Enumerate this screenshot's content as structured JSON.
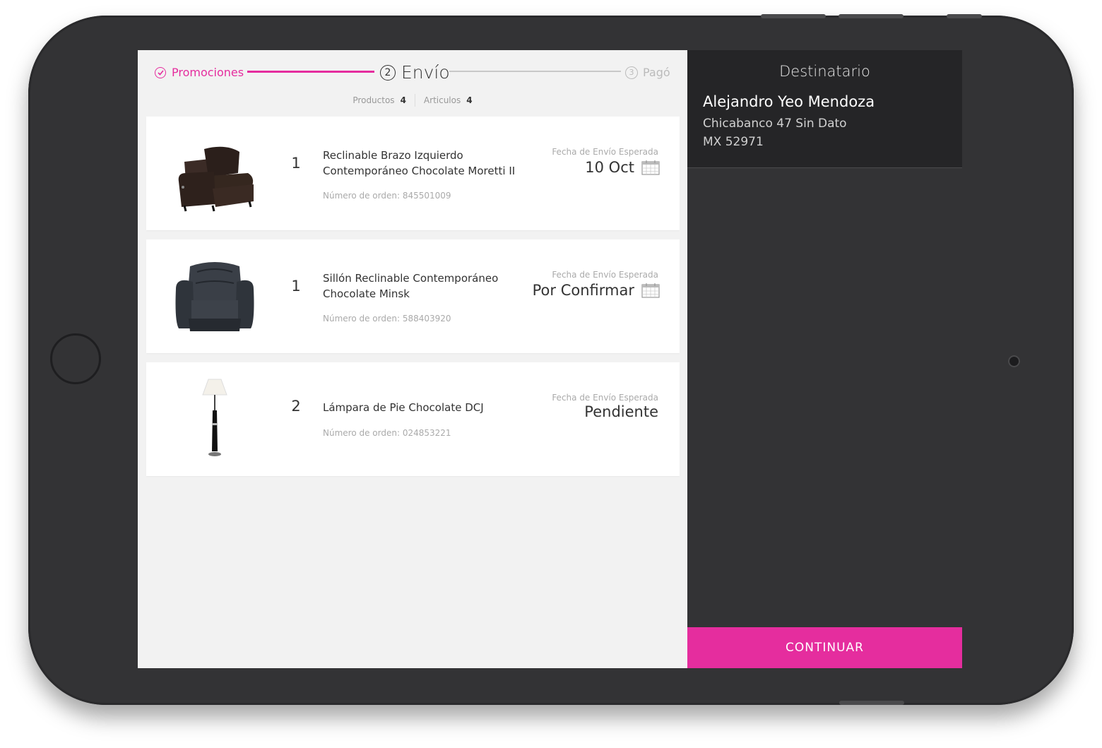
{
  "stepper": {
    "step1_label": "Promociones",
    "step2_num": "2",
    "step2_label": "Envío",
    "step3_num": "3",
    "step3_label": "Pagó"
  },
  "counts": {
    "productos_label": "Productos",
    "productos_value": "4",
    "articulos_label": "Articulos",
    "articulos_value": "4"
  },
  "orders": [
    {
      "qty": "1",
      "name": "Reclinable Brazo Izquierdo Contemporáneo Chocolate Moretti II",
      "order_label": "Número de orden: 845501009",
      "date_label": "Fecha de Envío Esperada",
      "date_value": "10 Oct"
    },
    {
      "qty": "1",
      "name": "Sillón Reclinable Contemporáneo Chocolate Minsk",
      "order_label": "Número de orden: 588403920",
      "date_label": "Fecha de Envío Esperada",
      "date_value": "Por Confirmar"
    },
    {
      "qty": "2",
      "name": "Lámpara de Pie Chocolate DCJ",
      "order_label": "Número de orden: 024853221",
      "date_label": "Fecha de Envío Esperada",
      "date_value": "Pendiente"
    }
  ],
  "recipient": {
    "title": "Destinatario",
    "name": "Alejandro Yeo Mendoza",
    "address_line1": "Chicabanco 47 Sin Dato",
    "address_line2": "MX 52971"
  },
  "continue_label": "CONTINUAR",
  "colors": {
    "accent": "#e52d9e",
    "dark_panel": "#333335",
    "recipient_bg": "#252527"
  }
}
